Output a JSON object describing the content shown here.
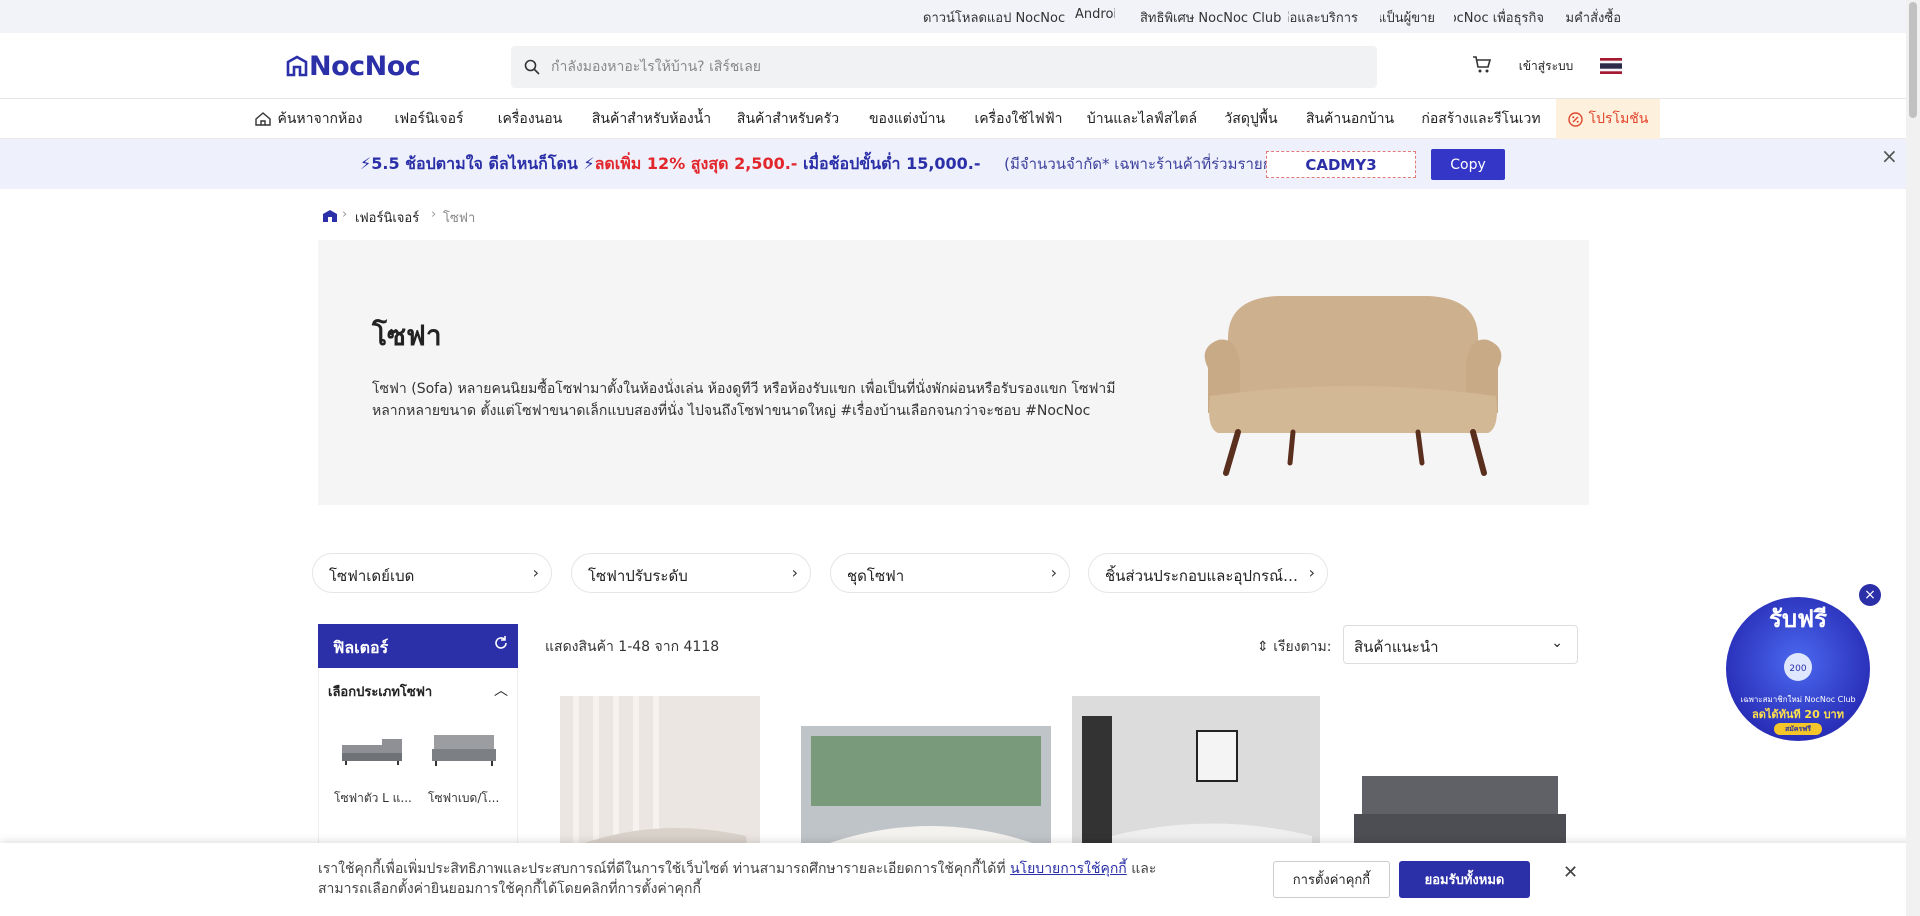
{
  "topbar": {
    "links": [
      "ดาวน์โหลดแอป NocNoc",
      "Android",
      "สิทธิพิเศษ NocNoc Club",
      "ความช่วยเหลือและบริการ",
      "เปิดร้านเป็นผู้ขาย",
      "NocNoc เพื่อธุรกิจ",
      "ติดตามคำสั่งซื้อ"
    ]
  },
  "header": {
    "logo": "NocNoc",
    "search_placeholder": "กำลังมองหาอะไรให้บ้าน? เสิร์ชเลย",
    "login_label": "เข้าสู่ระบบ"
  },
  "nav": {
    "items": [
      "ค้นหาจากห้อง",
      "เฟอร์นิเจอร์",
      "เครื่องนอน",
      "สินค้าสำหรับห้องน้ำ",
      "สินค้าสำหรับครัว",
      "ของแต่งบ้าน",
      "เครื่องใช้ไฟฟ้า",
      "บ้านและไลฟ์สไตล์",
      "วัสดุปูพื้น",
      "สินค้านอกบ้าน",
      "ก่อสร้างและรีโนเวท"
    ],
    "promo_label": "โปรโมชัน"
  },
  "promo_banner": {
    "part1": "⚡5.5 ช้อปตามใจ ดีลไหนก็โดน ⚡",
    "part2": "ลดเพิ่ม 12% สูงสุด 2,500.-",
    "part3": " เมื่อช้อปขั้นต่ำ 15,000.-",
    "note": "(มีจำนวนจำกัด* เฉพาะร้านค้าที่ร่วมรายการ)",
    "code": "CADMY3",
    "copy_label": "Copy",
    "close": "×"
  },
  "breadcrumb": {
    "items": [
      "เฟอร์นิเจอร์",
      "โซฟา"
    ]
  },
  "hero": {
    "title": "โซฟา",
    "description": "โซฟา (Sofa) หลายคนนิยมซื้อโซฟามาตั้งในห้องนั่งเล่น ห้องดูทีวี หรือห้องรับแขก เพื่อเป็นที่นั่งพักผ่อนหรือรับรองแขก โซฟามีหลากหลายขนาด ตั้งแต่โซฟาขนาดเล็กแบบสองที่นั่ง ไปจนถึงโซฟาขนาดใหญ่ #เรื่องบ้านเลือกจนกว่าจะชอบ #NocNoc"
  },
  "subcategories": [
    "โซฟาเดย์เบด",
    "โซฟาปรับระดับ",
    "ชุดโซฟา",
    "ชิ้นส่วนประกอบและอุปกรณ์เส..."
  ],
  "filter": {
    "title": "ฟิลเตอร์",
    "section": "เลือกประเภทโซฟา",
    "types": [
      "โซฟาตัว L แ...",
      "โซฟาเบด/โ..."
    ]
  },
  "listing": {
    "count": "แสดงสินค้า 1-48 จาก 4118",
    "sort_label": "เรียงตาม:",
    "sort_value": "สินค้าแนะนำ"
  },
  "club_badge": {
    "headline": "รับฟรี",
    "line1": "เฉพาะสมาชิกใหม่ NocNoc Club",
    "line2": "ลดได้ทันที 20 บาท",
    "cta": "สมัครฟรี"
  },
  "cookie": {
    "text_before": "เราใช้คุกกี้เพื่อเพิ่มประสิทธิภาพและประสบการณ์ที่ดีในการใช้เว็บไซต์ ท่านสามารถศึกษารายละเอียดการใช้คุกกี้ได้ที่ ",
    "link": "นโยบายการใช้คุกกี้",
    "text_after": " และสามารถเลือกตั้งค่ายินยอมการใช้คุกกี้ได้โดยคลิกที่การตั้งค่าคุกกี้",
    "settings_label": "การตั้งค่าคุกกี้",
    "accept_label": "ยอมรับทั้งหมด"
  },
  "colors": {
    "brand": "#2b2fa8",
    "promo_red": "#e2262c",
    "promo_bg": "#fdf0dc"
  },
  "icons": [
    "search-icon",
    "cart-icon",
    "flag-icon",
    "room-icon",
    "promo-icon",
    "home-icon",
    "refresh-icon",
    "chevron-down-icon",
    "close-icon"
  ]
}
